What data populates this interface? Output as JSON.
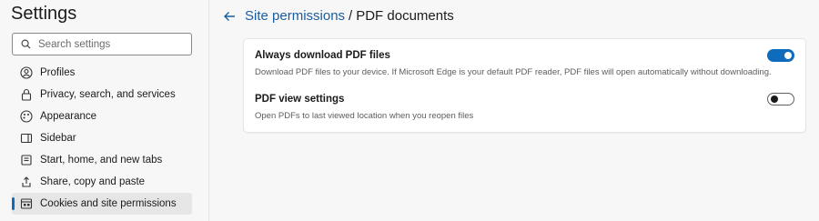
{
  "sidebar": {
    "title": "Settings",
    "search": {
      "placeholder": "Search settings",
      "value": ""
    },
    "items": [
      {
        "label": "Profiles",
        "icon": "profile-icon",
        "active": false
      },
      {
        "label": "Privacy, search, and services",
        "icon": "lock-icon",
        "active": false
      },
      {
        "label": "Appearance",
        "icon": "appearance-icon",
        "active": false
      },
      {
        "label": "Sidebar",
        "icon": "sidebar-icon",
        "active": false
      },
      {
        "label": "Start, home, and new tabs",
        "icon": "home-icon",
        "active": false
      },
      {
        "label": "Share, copy and paste",
        "icon": "share-icon",
        "active": false
      },
      {
        "label": "Cookies and site permissions",
        "icon": "cookies-icon",
        "active": true
      }
    ]
  },
  "header": {
    "breadcrumb_link": "Site permissions",
    "separator": "/",
    "current": "PDF documents"
  },
  "settings": [
    {
      "title": "Always download PDF files",
      "description": "Download PDF files to your device. If Microsoft Edge is your default PDF reader, PDF files will open automatically without downloading.",
      "enabled": true
    },
    {
      "title": "PDF view settings",
      "description": "Open PDFs to last viewed location when you reopen files",
      "enabled": false
    }
  ],
  "colors": {
    "accent": "#0f6cbd",
    "link": "#1a5d9e"
  }
}
